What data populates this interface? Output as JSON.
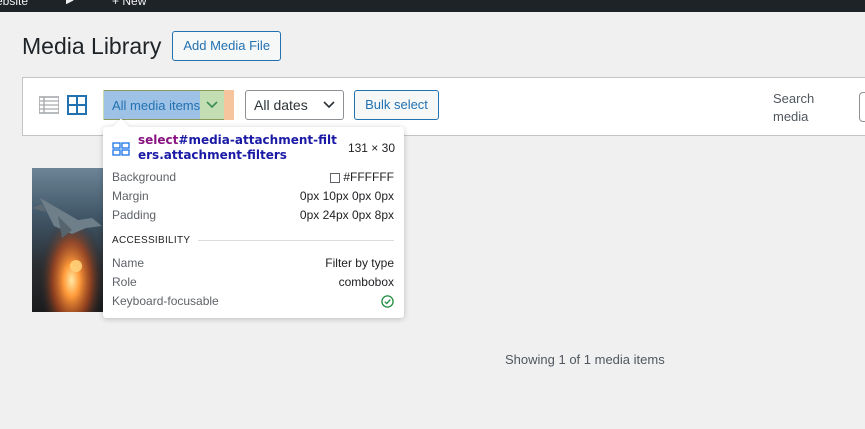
{
  "admin_bar": {
    "fragment_left": "ebsite",
    "fragment_new": "New"
  },
  "page": {
    "title": "Media Library",
    "add_button": "Add Media File"
  },
  "toolbar": {
    "filter_selected": "All media items",
    "dates_selected": "All dates",
    "bulk_label": "Bulk select",
    "search_label": "Search media"
  },
  "footer": {
    "showing": "Showing 1 of 1 media items"
  },
  "inspector": {
    "selector_tag": "select",
    "selector_rest": "#media-attachment-filters.attachment-filters",
    "dims": "131 × 30",
    "rows": [
      {
        "label": "Background",
        "value": "#FFFFFF",
        "swatch": "#FFFFFF"
      },
      {
        "label": "Margin",
        "value": "0px 10px 0px 0px"
      },
      {
        "label": "Padding",
        "value": "0px 24px 0px 8px"
      }
    ],
    "section_title": "ACCESSIBILITY",
    "a11y": [
      {
        "label": "Name",
        "value": "Filter by type"
      },
      {
        "label": "Role",
        "value": "combobox"
      },
      {
        "label": "Keyboard-focusable",
        "value_icon": "check-circle-icon"
      }
    ]
  },
  "colors": {
    "accent": "#2271b1",
    "content_highlight": "#9ec2e6",
    "padding_highlight": "#c3deb2",
    "margin_highlight": "#f7c59d",
    "check": "#1e8e3e"
  }
}
